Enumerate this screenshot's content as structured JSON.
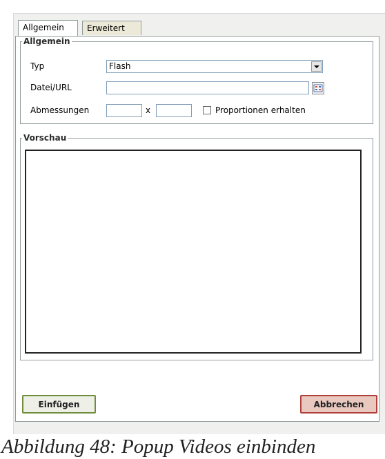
{
  "tabs": [
    {
      "label": "Allgemein",
      "active": true
    },
    {
      "label": "Erweitert",
      "active": false
    }
  ],
  "general": {
    "legend": "Allgemein",
    "type_label": "Typ",
    "type_value": "Flash",
    "file_label": "Datei/URL",
    "file_value": "",
    "dimensions_label": "Abmessungen",
    "width_value": "",
    "times_sign": "x",
    "height_value": "",
    "keep_proportions_label": "Proportionen erhalten",
    "keep_proportions_checked": false
  },
  "preview": {
    "legend": "Vorschau"
  },
  "buttons": {
    "insert": "Einfügen",
    "cancel": "Abbrechen"
  },
  "caption": "Abbildung 48: Popup Videos einbinden",
  "icons": {
    "dropdown": "chevron-down-icon",
    "browse": "browse-icon"
  }
}
